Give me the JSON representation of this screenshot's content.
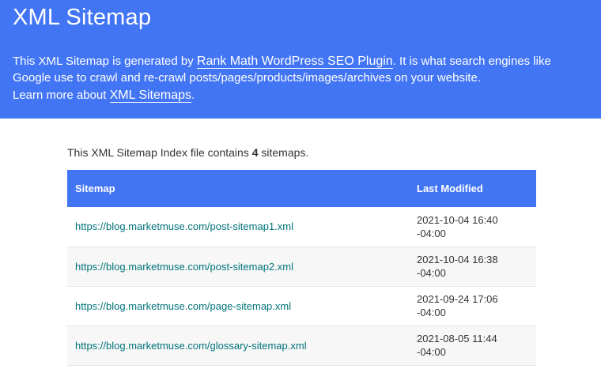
{
  "header": {
    "title": "XML Sitemap",
    "intro_prefix": "This XML Sitemap is generated by ",
    "plugin_link": "Rank Math WordPress SEO Plugin",
    "intro_suffix": ". It is what search engines like Google use to crawl and re-crawl posts/pages/products/images/archives on your website.",
    "learn_prefix": "Learn more about ",
    "learn_link": "XML Sitemaps",
    "learn_suffix": ".",
    "background_color": "#4275f4"
  },
  "summary": {
    "prefix": "This XML Sitemap Index file contains ",
    "count": "4",
    "suffix": " sitemaps."
  },
  "table": {
    "columns": [
      "Sitemap",
      "Last Modified"
    ],
    "rows": [
      {
        "url": "https://blog.marketmuse.com/post-sitemap1.xml",
        "date": "2021-10-04 16:40",
        "tz": "-04:00"
      },
      {
        "url": "https://blog.marketmuse.com/post-sitemap2.xml",
        "date": "2021-10-04 16:38",
        "tz": "-04:00"
      },
      {
        "url": "https://blog.marketmuse.com/page-sitemap.xml",
        "date": "2021-09-24 17:06",
        "tz": "-04:00"
      },
      {
        "url": "https://blog.marketmuse.com/glossary-sitemap.xml",
        "date": "2021-08-05 11:44",
        "tz": "-04:00"
      }
    ],
    "link_color": "#00737a"
  }
}
